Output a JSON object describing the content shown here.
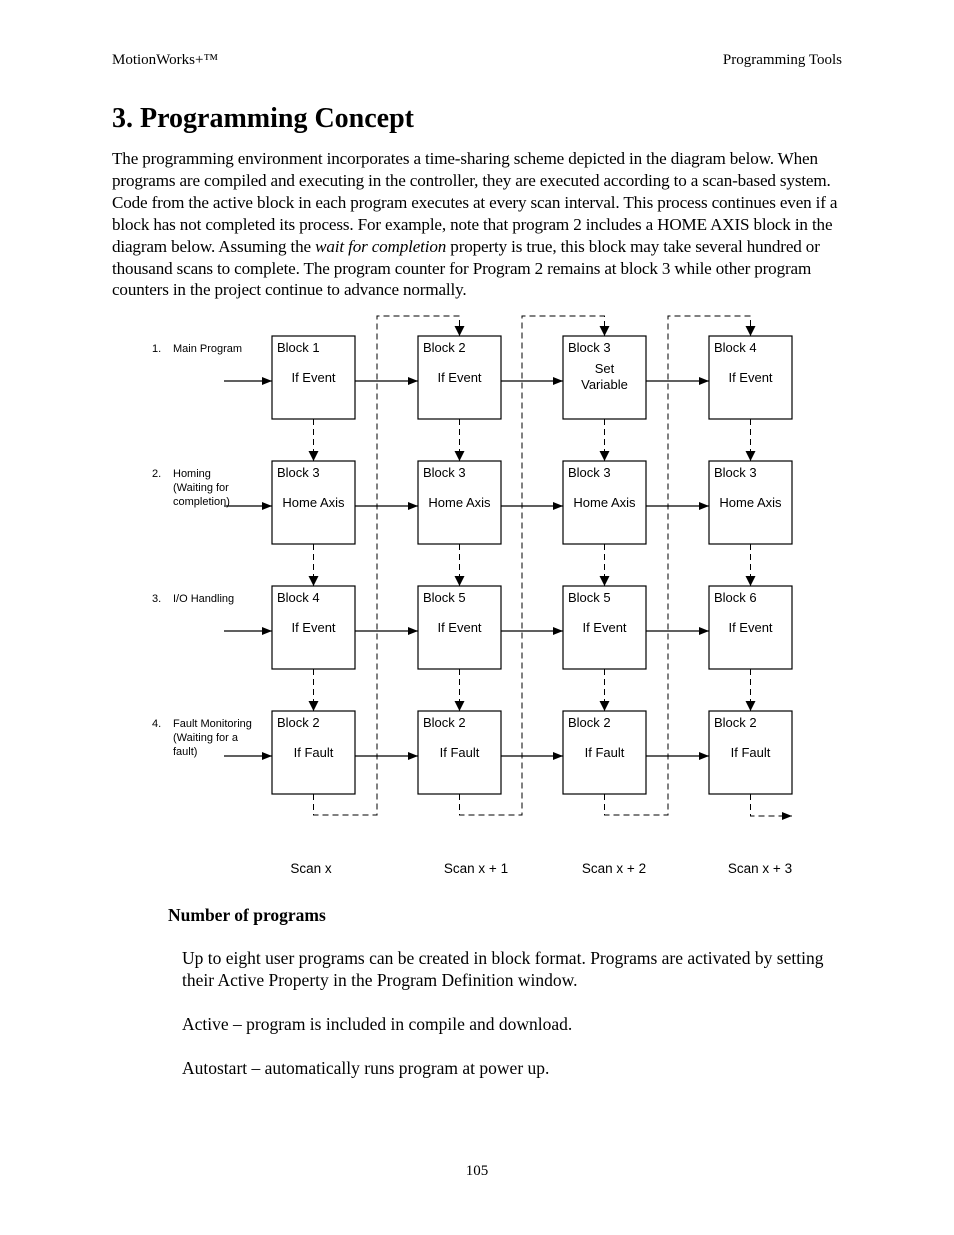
{
  "header": {
    "left": "MotionWorks+™",
    "right": "Programming Tools"
  },
  "title": "3. Programming Concept",
  "intro": {
    "before_italic": "The programming environment incorporates a time-sharing scheme depicted in the diagram below. When programs are compiled and executing in the controller, they are executed according to a scan-based system.  Code from the active block in each program executes at every scan interval.  This process continues even if a block has not completed its process.  For example, note that program 2 includes a HOME AXIS block in the diagram below.  Assuming the ",
    "italic": "wait for completion",
    "after_italic": " property is true, this block may take several hundred or thousand scans to complete.  The program counter for Program 2 remains at block 3 while other program counters in the project continue to advance normally."
  },
  "diagram": {
    "rows": [
      {
        "number": "1.",
        "label_lines": [
          "Main Program"
        ]
      },
      {
        "number": "2.",
        "label_lines": [
          "Homing",
          "(Waiting for",
          "completion)"
        ]
      },
      {
        "number": "3.",
        "label_lines": [
          "I/O Handling"
        ]
      },
      {
        "number": "4.",
        "label_lines": [
          "Fault Monitoring",
          "(Waiting for a",
          "fault)"
        ]
      }
    ],
    "scans": [
      "Scan x",
      "Scan x + 1",
      "Scan x + 2",
      "Scan x + 3"
    ],
    "blocks": [
      [
        {
          "name": "Block 1",
          "action": [
            "If Event"
          ]
        },
        {
          "name": "Block 2",
          "action": [
            "If Event"
          ]
        },
        {
          "name": "Block 3",
          "action": [
            "Set",
            "Variable"
          ]
        },
        {
          "name": "Block 4",
          "action": [
            "If Event"
          ]
        }
      ],
      [
        {
          "name": "Block 3",
          "action": [
            "Home Axis"
          ]
        },
        {
          "name": "Block 3",
          "action": [
            "Home Axis"
          ]
        },
        {
          "name": "Block 3",
          "action": [
            "Home Axis"
          ]
        },
        {
          "name": "Block 3",
          "action": [
            "Home Axis"
          ]
        }
      ],
      [
        {
          "name": "Block 4",
          "action": [
            "If Event"
          ]
        },
        {
          "name": "Block 5",
          "action": [
            "If Event"
          ]
        },
        {
          "name": "Block 5",
          "action": [
            "If Event"
          ]
        },
        {
          "name": "Block 6",
          "action": [
            "If Event"
          ]
        }
      ],
      [
        {
          "name": "Block 2",
          "action": [
            "If Fault"
          ]
        },
        {
          "name": "Block 2",
          "action": [
            "If Fault"
          ]
        },
        {
          "name": "Block 2",
          "action": [
            "If Fault"
          ]
        },
        {
          "name": "Block 2",
          "action": [
            "If Fault"
          ]
        }
      ]
    ]
  },
  "section": {
    "title": "Number of programs",
    "paragraphs": [
      "Up to eight user programs can be created in block format.  Programs are activated by setting their Active Property in the Program Definition window.",
      "Active – program is included in compile and download.",
      "Autostart – automatically runs program at power up."
    ]
  },
  "footer": {
    "page_number": "105"
  }
}
